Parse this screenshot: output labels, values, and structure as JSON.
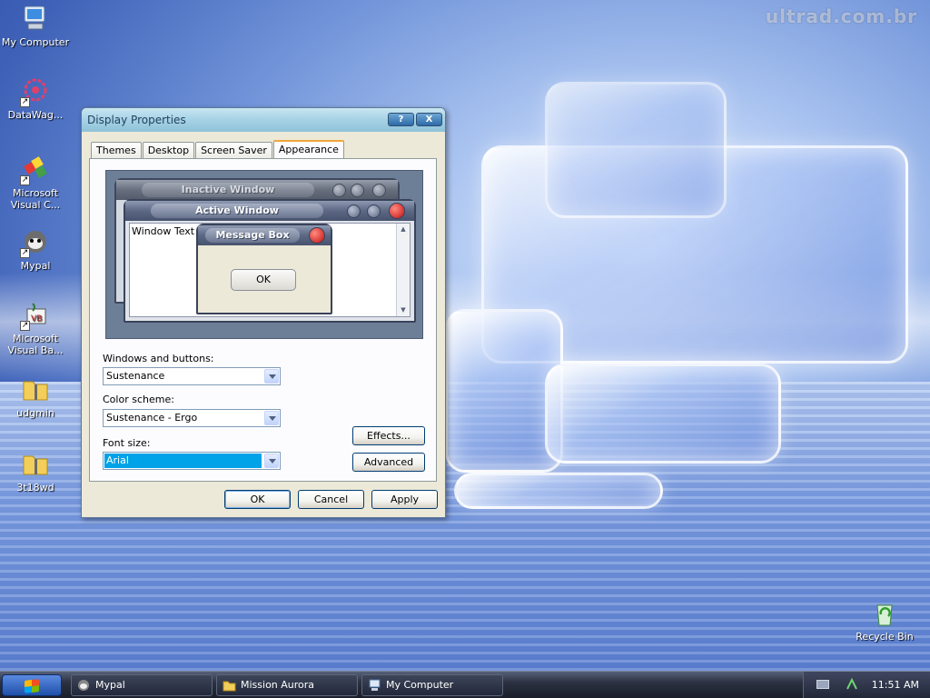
{
  "desktop": {
    "watermark": "ultrad.com.br",
    "icons": [
      {
        "label": "My Computer"
      },
      {
        "label": "DataWag..."
      },
      {
        "label": "Microsoft Visual C..."
      },
      {
        "label": "Mypal"
      },
      {
        "label": "Microsoft Visual Ba..."
      },
      {
        "label": "udgmin"
      },
      {
        "label": "3t18wd"
      },
      {
        "label": "Recycle Bin"
      }
    ]
  },
  "dialog": {
    "title": "Display Properties",
    "help_label": "?",
    "close_label": "X",
    "tabs": [
      {
        "label": "Themes"
      },
      {
        "label": "Desktop"
      },
      {
        "label": "Screen Saver"
      },
      {
        "label": "Appearance"
      }
    ],
    "active_tab": "Appearance",
    "preview": {
      "inactive_window": "Inactive Window",
      "active_window": "Active Window",
      "window_text": "Window Text",
      "message_box": "Message Box",
      "ok": "OK"
    },
    "windows_and_buttons": {
      "label": "Windows and buttons:",
      "value": "Sustenance"
    },
    "color_scheme": {
      "label": "Color scheme:",
      "value": "Sustenance - Ergo"
    },
    "font_size": {
      "label": "Font size:",
      "value": "Arial"
    },
    "effects_button": "Effects...",
    "advanced_button": "Advanced",
    "ok_button": "OK",
    "cancel_button": "Cancel",
    "apply_button": "Apply"
  },
  "taskbar": {
    "tasks": [
      {
        "label": "Mypal"
      },
      {
        "label": "Mission Aurora"
      },
      {
        "label": "My Computer"
      }
    ],
    "clock": "11:51 AM"
  },
  "colors": {
    "selection": "#00a2e8",
    "tab_highlight": "#f1a63b",
    "preview_close": "#c50f0f"
  }
}
